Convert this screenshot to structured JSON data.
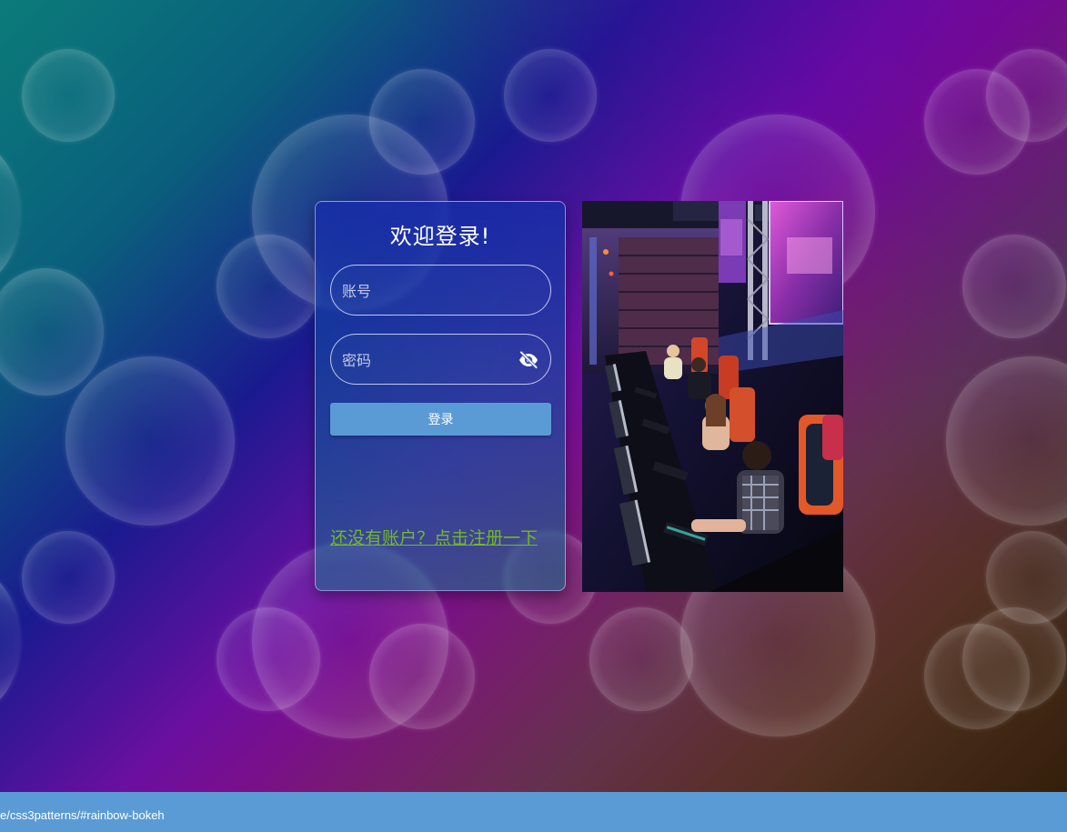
{
  "login": {
    "title": "欢迎登录!",
    "account_placeholder": "账号",
    "password_placeholder": "密码",
    "account_value": "",
    "password_value": "",
    "toggle_icon": "eye-off-icon",
    "submit_label": "登录",
    "register_link_text": "还没有账户？点击注册一下"
  },
  "image_panel": {
    "subject": "esports players at gaming computers"
  },
  "status_bar": {
    "url_text": "e/css3patterns/#rainbow-bokeh"
  },
  "colors": {
    "button": "#5b9bd5",
    "status_bar": "#5b9bd5",
    "link": "#74b72a",
    "card_border": "#dce6ff"
  }
}
